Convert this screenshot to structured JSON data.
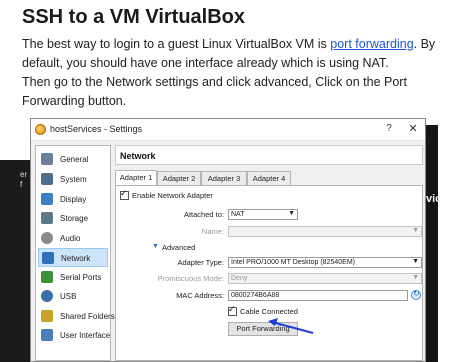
{
  "article": {
    "title": "SSH to a VM VirtualBox",
    "intro_text": "The best way to login to a guest Linux VirtualBox VM is ",
    "link_text": "port forwarding",
    "intro_text_2": ". By default, you should have one interface already which is using NAT.",
    "paragraph_2": "Then go to the Network settings and click advanced, Click on the Port Forwarding button."
  },
  "background": {
    "left_fragments": [
      "er",
      "f"
    ],
    "right_fragment": "vic"
  },
  "window": {
    "title": "hostServices - Settings",
    "help_label": "?",
    "close_label": "✕"
  },
  "sidebar": {
    "items": [
      {
        "label": "General",
        "icon": "general-icon",
        "color": "#6a7f99"
      },
      {
        "label": "System",
        "icon": "system-icon",
        "color": "#4d6f8f"
      },
      {
        "label": "Display",
        "icon": "display-icon",
        "color": "#3d7fc2"
      },
      {
        "label": "Storage",
        "icon": "storage-icon",
        "color": "#5a7a8a"
      },
      {
        "label": "Audio",
        "icon": "audio-icon",
        "color": "#8a8a8a"
      },
      {
        "label": "Network",
        "icon": "network-icon",
        "color": "#2e6fb5",
        "selected": true
      },
      {
        "label": "Serial Ports",
        "icon": "serial-ports-icon",
        "color": "#3f8f3f"
      },
      {
        "label": "USB",
        "icon": "usb-icon",
        "color": "#3b6ea8"
      },
      {
        "label": "Shared Folders",
        "icon": "shared-folders-icon",
        "color": "#c9a227"
      },
      {
        "label": "User Interface",
        "icon": "user-interface-icon",
        "color": "#4b7fb8"
      }
    ]
  },
  "content": {
    "section_title": "Network",
    "tabs": [
      "Adapter 1",
      "Adapter 2",
      "Adapter 3",
      "Adapter 4"
    ],
    "active_tab": "Adapter 1",
    "enable_adapter_label": "Enable Network Adapter",
    "enable_adapter_checked": "✓",
    "attached_to_label": "Attached to:",
    "attached_to_value": "NAT",
    "name_label": "Name:",
    "name_value": "",
    "advanced_label": "Advanced",
    "adapter_type_label": "Adapter Type:",
    "adapter_type_value": "Intel PRO/1000 MT Desktop (82540EM)",
    "promiscuous_label": "Promiscuous Mode:",
    "promiscuous_value": "Deny",
    "mac_label": "MAC Address:",
    "mac_value": "0800274B6A88",
    "cable_connected_label": "Cable Connected",
    "cable_connected_checked": "✓",
    "port_forwarding_label": "Port Forwarding",
    "dropdown_arrow": "▼",
    "advanced_arrow": "▼"
  },
  "colors": {
    "link": "#1a55d6",
    "selection": "#cde4fa",
    "annotation_arrow": "#1f3fd8"
  }
}
